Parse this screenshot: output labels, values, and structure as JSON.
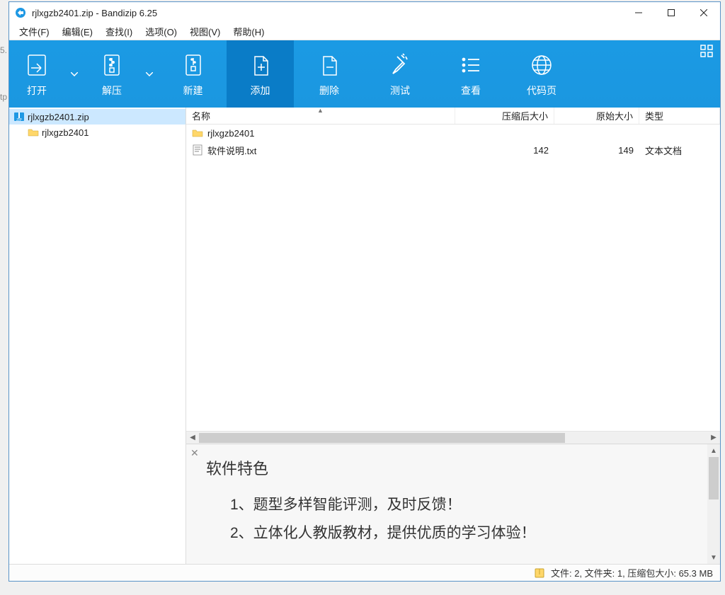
{
  "window": {
    "title": "rjlxgzb2401.zip - Bandizip 6.25"
  },
  "menubar": {
    "file": "文件(F)",
    "edit": "编辑(E)",
    "find": "查找(I)",
    "options": "选项(O)",
    "view": "视图(V)",
    "help": "帮助(H)"
  },
  "toolbar": {
    "open": "打开",
    "extract": "解压",
    "new": "新建",
    "add": "添加",
    "delete": "删除",
    "test": "测试",
    "view": "查看",
    "codepage": "代码页"
  },
  "tree": {
    "root": "rjlxgzb2401.zip",
    "child": "rjlxgzb2401"
  },
  "columns": {
    "name": "名称",
    "compressed": "压缩后大小",
    "original": "原始大小",
    "type": "类型"
  },
  "rows": [
    {
      "name": "rjlxgzb2401",
      "icon": "folder",
      "compressed": "",
      "original": "",
      "type": ""
    },
    {
      "name": "软件说明.txt",
      "icon": "txt",
      "compressed": "142",
      "original": "149",
      "type": "文本文档"
    }
  ],
  "preview": {
    "title": "软件特色",
    "line1": "1、题型多样智能评测，及时反馈！",
    "line2": "2、立体化人教版教材，提供优质的学习体验！"
  },
  "status": {
    "text": "文件: 2, 文件夹: 1, 压缩包大小: 65.3 MB"
  }
}
